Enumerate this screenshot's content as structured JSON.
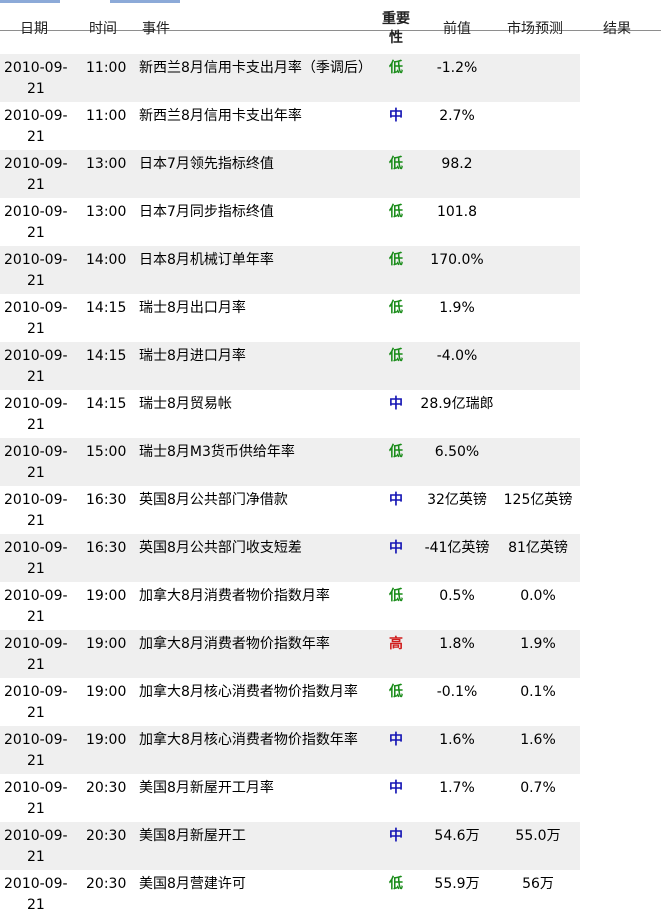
{
  "colors": {
    "low": "#1a8c1a",
    "mid": "#1414b4",
    "high": "#d01c1c",
    "row_shade": "#efefef"
  },
  "headers": {
    "date": "日期",
    "time": "时间",
    "event": "事件",
    "importance": "重要性",
    "previous": "前值",
    "forecast": "市场预测",
    "result": "结果"
  },
  "rows": [
    {
      "date_a": "2010-09-",
      "date_b": "21",
      "time": "11:00",
      "event": "新西兰8月信用卡支出月率（季调后）",
      "importance": "低",
      "level": "low",
      "previous": "-1.2%",
      "forecast": "",
      "result": ""
    },
    {
      "date_a": "2010-09-",
      "date_b": "21",
      "time": "11:00",
      "event": "新西兰8月信用卡支出年率",
      "importance": "中",
      "level": "mid",
      "previous": "2.7%",
      "forecast": "",
      "result": ""
    },
    {
      "date_a": "2010-09-",
      "date_b": "21",
      "time": "13:00",
      "event": "日本7月领先指标终值",
      "importance": "低",
      "level": "low",
      "previous": "98.2",
      "forecast": "",
      "result": ""
    },
    {
      "date_a": "2010-09-",
      "date_b": "21",
      "time": "13:00",
      "event": "日本7月同步指标终值",
      "importance": "低",
      "level": "low",
      "previous": "101.8",
      "forecast": "",
      "result": ""
    },
    {
      "date_a": "2010-09-",
      "date_b": "21",
      "time": "14:00",
      "event": "日本8月机械订单年率",
      "importance": "低",
      "level": "low",
      "previous": "170.0%",
      "forecast": "",
      "result": ""
    },
    {
      "date_a": "2010-09-",
      "date_b": "21",
      "time": "14:15",
      "event": "瑞士8月出口月率",
      "importance": "低",
      "level": "low",
      "previous": "1.9%",
      "forecast": "",
      "result": ""
    },
    {
      "date_a": "2010-09-",
      "date_b": "21",
      "time": "14:15",
      "event": "瑞士8月进口月率",
      "importance": "低",
      "level": "low",
      "previous": "-4.0%",
      "forecast": "",
      "result": ""
    },
    {
      "date_a": "2010-09-",
      "date_b": "21",
      "time": "14:15",
      "event": "瑞士8月贸易帐",
      "importance": "中",
      "level": "mid",
      "previous": "28.9亿瑞郎",
      "forecast": "",
      "result": ""
    },
    {
      "date_a": "2010-09-",
      "date_b": "21",
      "time": "15:00",
      "event": "瑞士8月M3货币供给年率",
      "importance": "低",
      "level": "low",
      "previous": "6.50%",
      "forecast": "",
      "result": ""
    },
    {
      "date_a": "2010-09-",
      "date_b": "21",
      "time": "16:30",
      "event": "英国8月公共部门净借款",
      "importance": "中",
      "level": "mid",
      "previous": "32亿英镑",
      "forecast": "125亿英镑",
      "result": ""
    },
    {
      "date_a": "2010-09-",
      "date_b": "21",
      "time": "16:30",
      "event": "英国8月公共部门收支短差",
      "importance": "中",
      "level": "mid",
      "previous": "-41亿英镑",
      "forecast": "81亿英镑",
      "result": ""
    },
    {
      "date_a": "2010-09-",
      "date_b": "21",
      "time": "19:00",
      "event": "加拿大8月消费者物价指数月率",
      "importance": "低",
      "level": "low",
      "previous": "0.5%",
      "forecast": "0.0%",
      "result": ""
    },
    {
      "date_a": "2010-09-",
      "date_b": "21",
      "time": "19:00",
      "event": "加拿大8月消费者物价指数年率",
      "importance": "高",
      "level": "high",
      "previous": "1.8%",
      "forecast": "1.9%",
      "result": ""
    },
    {
      "date_a": "2010-09-",
      "date_b": "21",
      "time": "19:00",
      "event": "加拿大8月核心消费者物价指数月率",
      "importance": "低",
      "level": "low",
      "previous": "-0.1%",
      "forecast": "0.1%",
      "result": ""
    },
    {
      "date_a": "2010-09-",
      "date_b": "21",
      "time": "19:00",
      "event": "加拿大8月核心消费者物价指数年率",
      "importance": "中",
      "level": "mid",
      "previous": "1.6%",
      "forecast": "1.6%",
      "result": ""
    },
    {
      "date_a": "2010-09-",
      "date_b": "21",
      "time": "20:30",
      "event": "美国8月新屋开工月率",
      "importance": "中",
      "level": "mid",
      "previous": "1.7%",
      "forecast": "0.7%",
      "result": ""
    },
    {
      "date_a": "2010-09-",
      "date_b": "21",
      "time": "20:30",
      "event": "美国8月新屋开工",
      "importance": "中",
      "level": "mid",
      "previous": "54.6万",
      "forecast": "55.0万",
      "result": ""
    },
    {
      "date_a": "2010-09-",
      "date_b": "21",
      "time": "20:30",
      "event": "美国8月营建许可",
      "importance": "低",
      "level": "low",
      "previous": "55.9万",
      "forecast": "56万",
      "result": ""
    }
  ]
}
